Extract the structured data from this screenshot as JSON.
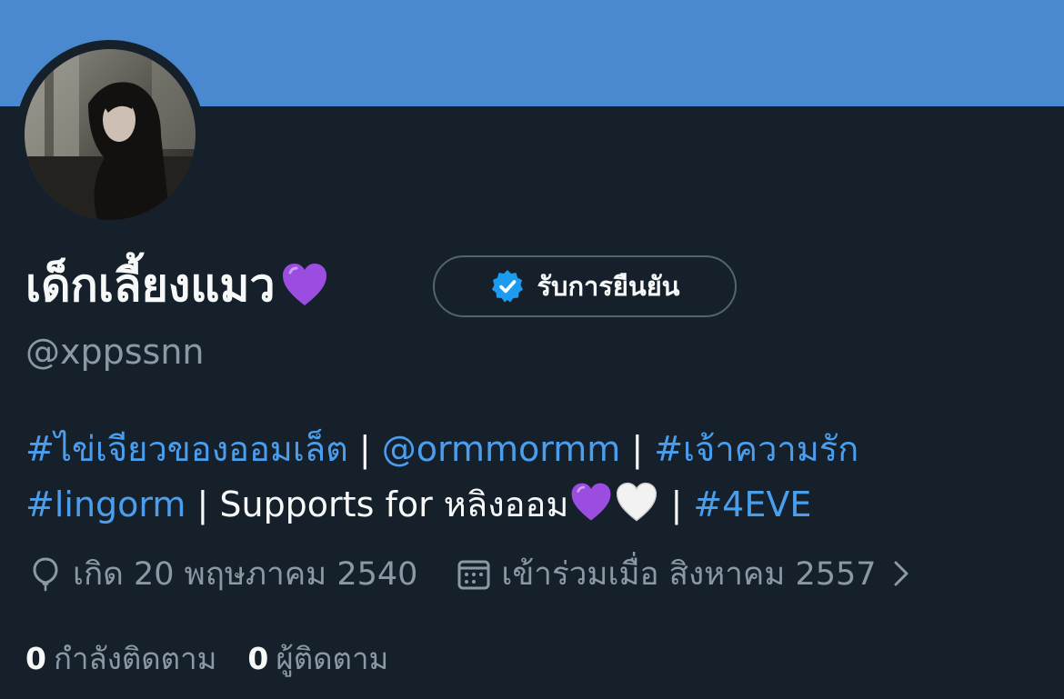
{
  "profile": {
    "display_name": "เด็กเลี้ยงแมว",
    "name_emoji": "purple-heart-emoji",
    "handle": "@xppssnn",
    "verify_button_label": "รับการยืนยัน"
  },
  "bio": {
    "hashtag1": "#ไข่เจียวของออมเล็ต",
    "sep1": " | ",
    "mention": "@ormmormm",
    "sep2": " | ",
    "hashtag2": "#เจ้าความรัก",
    "hashtag3": "#lingorm",
    "sep3": " | ",
    "text": "Supports for หลิงออม",
    "emojis": [
      "purple-heart-emoji",
      "white-heart-emoji"
    ],
    "sep4": " | ",
    "hashtag4": "#4EVE"
  },
  "meta": {
    "birthday": "เกิด 20 พฤษภาคม 2540",
    "joined": "เข้าร่วมเมื่อ สิงหาคม 2557",
    "icons": [
      "balloon-icon",
      "calendar-icon",
      "chevron-right-icon"
    ]
  },
  "stats": {
    "following_count": "0",
    "following_label": "กำลังติดตาม",
    "followers_count": "0",
    "followers_label": "ผู้ติดตาม"
  },
  "colors": {
    "background": "#15202b",
    "banner": "#4a89cf",
    "link": "#4a9eed",
    "muted": "#8b98a5",
    "verified_badge": "#1d9bf0",
    "purple_heart": "#9b4de0"
  }
}
